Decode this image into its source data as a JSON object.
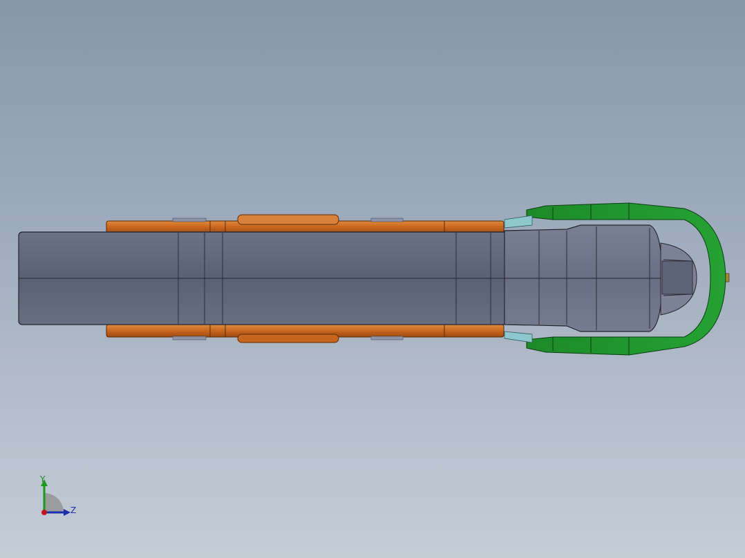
{
  "viewport": {
    "background_top": "#8797ab",
    "background_bottom": "#c4ccd6"
  },
  "model": {
    "parts": [
      {
        "name": "handle-body",
        "color": "#5d6478"
      },
      {
        "name": "side-rails",
        "color": "#c8661f"
      },
      {
        "name": "clip-guard",
        "color": "#1f8c2b"
      },
      {
        "name": "connector",
        "color": "#7fbfc8"
      }
    ]
  },
  "triad": {
    "y_label": "Y",
    "z_label": "Z",
    "y_color": "#1c9a1c",
    "z_color": "#1c2ea8",
    "origin_color": "#c0141e"
  }
}
